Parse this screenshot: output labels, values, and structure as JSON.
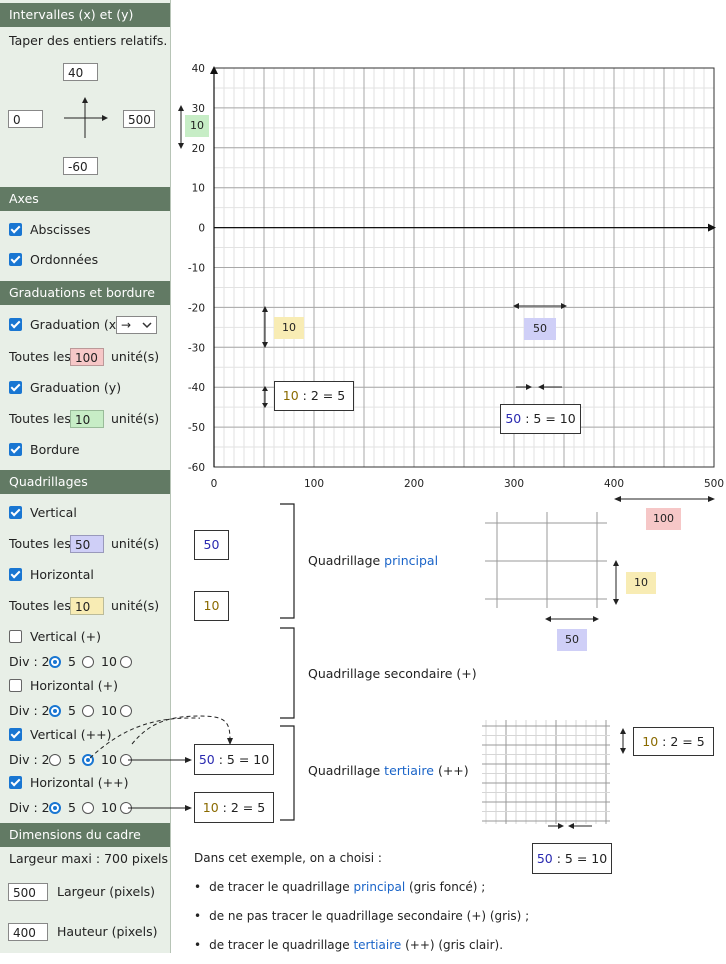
{
  "sidebar": {
    "intervals": {
      "title": "Intervalles (x) et (y)",
      "hint": "Taper des entiers relatifs.",
      "top": "40",
      "left": "0",
      "right": "500",
      "bottom": "-60"
    },
    "axes": {
      "title": "Axes",
      "abscisses": "Abscisses",
      "ordonnees": "Ordonnées"
    },
    "grad": {
      "title": "Graduations et bordure",
      "grad_x": "Graduation (x)",
      "arrow_option": "→",
      "every": "Toutes les",
      "unit": "unité(s)",
      "x_value": "100",
      "grad_y": "Graduation (y)",
      "y_value": "10",
      "border": "Bordure"
    },
    "grids": {
      "title": "Quadrillages",
      "vertical": "Vertical",
      "every": "Toutes les",
      "unit": "unité(s)",
      "v_value": "50",
      "horizontal": "Horizontal",
      "h_value": "10",
      "vertical_plus": "Vertical (+)",
      "horizontal_plus": "Horizontal (+)",
      "vertical_pp": "Vertical (++)",
      "horizontal_pp": "Horizontal (++)",
      "div": "Div : 2",
      "o5": "5",
      "o10": "10"
    },
    "frame": {
      "title": "Dimensions du cadre",
      "max_width": "Largeur maxi : 700 pixels",
      "width_value": "500",
      "width_label": "Largeur (pixels)",
      "height_value": "400",
      "height_label": "Hauteur (pixels)"
    }
  },
  "chart_data": {
    "type": "line",
    "xlim": [
      0,
      500
    ],
    "ylim": [
      -60,
      40
    ],
    "x_ticks": [
      "0",
      "100",
      "200",
      "300",
      "400",
      "500"
    ],
    "y_ticks": [
      "40",
      "30",
      "20",
      "10",
      "0",
      "-10",
      "-20",
      "-30",
      "-40",
      "-50",
      "-60"
    ],
    "grid_major": {
      "x_step": 50,
      "y_step": 10
    },
    "grid_minor": {
      "x_step": 10,
      "y_step": 5
    },
    "annotations": {
      "y_span": "10",
      "xmajor": "50",
      "ysub": "10",
      "ysub_a": "10",
      "ysub_b": "2 = 5",
      "xsub_a": "50",
      "xsub_b": "5 = 10",
      "x_grad": "100"
    }
  },
  "legend": {
    "major_x": "50",
    "major_y": "10",
    "principal_pre": "Quadrillage ",
    "principal_word": "principal",
    "secondaire": "Quadrillage secondaire (+)",
    "tertiaire_pre": "Quadrillage ",
    "tertiaire_word": "tertiaire",
    "tertiaire_post": " (++)",
    "box_50": "50",
    "box_5": "5 = 10",
    "box_10": "10",
    "box_2": "2 = 5",
    "big_grid_y": "10",
    "big_grid_x": "50",
    "big_grid_top": "100",
    "t_y": "10",
    "t_y2": "2 = 5",
    "t_x": "50",
    "t_x2": "5 = 10"
  },
  "notes": {
    "intro": "Dans cet exemple, on a choisi :",
    "b1_pre": "de tracer le quadrillage ",
    "b1_word": "principal",
    "b1_post": " (gris foncé) ;",
    "b2": "de ne pas tracer le quadrillage secondaire (+) (gris) ;",
    "b3_pre": "de tracer le quadrillage ",
    "b3_word": "tertiaire",
    "b3_post": " (++) (gris clair)."
  }
}
